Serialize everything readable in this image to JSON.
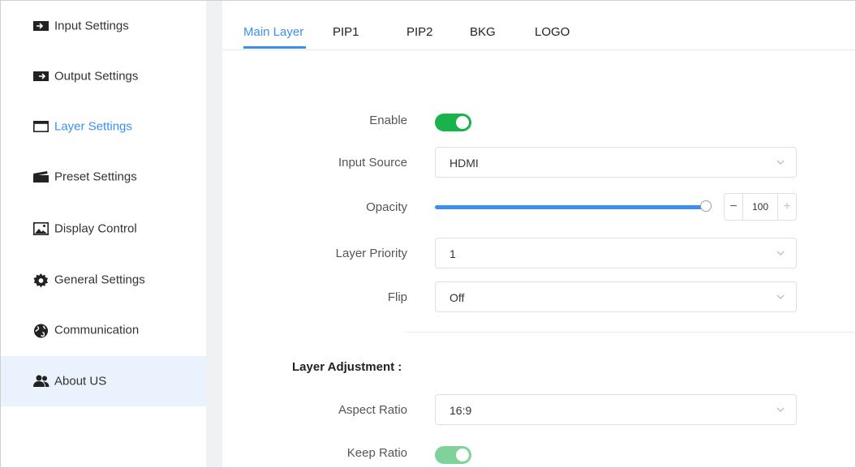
{
  "sidebar": {
    "items": [
      {
        "label": "Input Settings",
        "icon": "input-icon"
      },
      {
        "label": "Output Settings",
        "icon": "output-icon"
      },
      {
        "label": "Layer Settings",
        "icon": "layer-icon"
      },
      {
        "label": "Preset Settings",
        "icon": "clapperboard-icon"
      },
      {
        "label": "Display Control",
        "icon": "image-icon"
      },
      {
        "label": "General Settings",
        "icon": "gear-icon"
      },
      {
        "label": "Communication",
        "icon": "globe-icon"
      },
      {
        "label": "About US",
        "icon": "users-icon"
      }
    ],
    "selected": "Layer Settings"
  },
  "tabs": [
    "Main Layer",
    "PIP1",
    "PIP2",
    "BKG",
    "LOGO"
  ],
  "active_tab": "Main Layer",
  "form": {
    "enable": {
      "label": "Enable",
      "on": true
    },
    "input_source": {
      "label": "Input Source",
      "value": "HDMI"
    },
    "opacity": {
      "label": "Opacity",
      "value": "100",
      "minus": "−",
      "plus": "+"
    },
    "layer_priority": {
      "label": "Layer Priority",
      "value": "1"
    },
    "flip": {
      "label": "Flip",
      "value": "Off"
    }
  },
  "adjustment": {
    "title": "Layer Adjustment :",
    "aspect_ratio": {
      "label": "Aspect Ratio",
      "value": "16:9"
    },
    "keep_ratio": {
      "label": "Keep Ratio",
      "on": true,
      "disabled": true
    }
  },
  "colors": {
    "accent": "#3d8fee",
    "switch_on": "#1ab24b",
    "switch_disabled": "#7fd39a",
    "active_bg": "#eaf2fd",
    "gutter": "#f0f1f3"
  }
}
